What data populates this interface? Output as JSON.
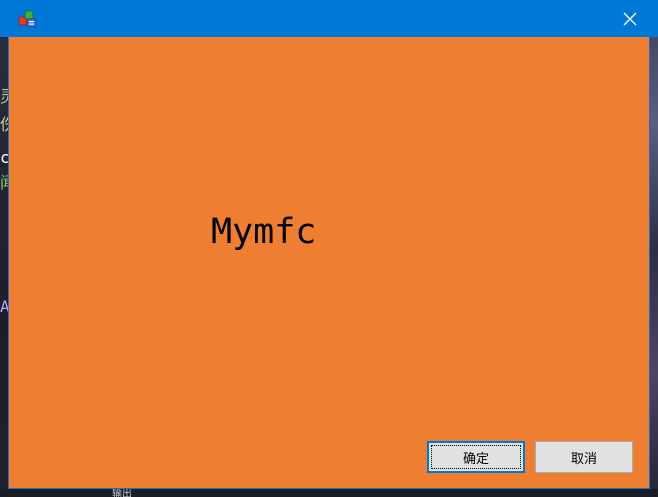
{
  "window": {
    "icon": "mfc-app-icon",
    "close_icon": "close-icon",
    "titlebar_color": "#0078d7",
    "client_color": "#ee7f32"
  },
  "dialog": {
    "label": "Mymfc",
    "ok_label": "确定",
    "cancel_label": "取消"
  },
  "background": {
    "left_glyphs": [
      "灵",
      "伤",
      "c",
      "闻",
      "A"
    ],
    "left_glyph_colors": [
      "#9fd39a",
      "#d8c8a0",
      "#ffffff",
      "#7fd06a",
      "#b0a6ff"
    ],
    "bottom_text": "输出"
  }
}
